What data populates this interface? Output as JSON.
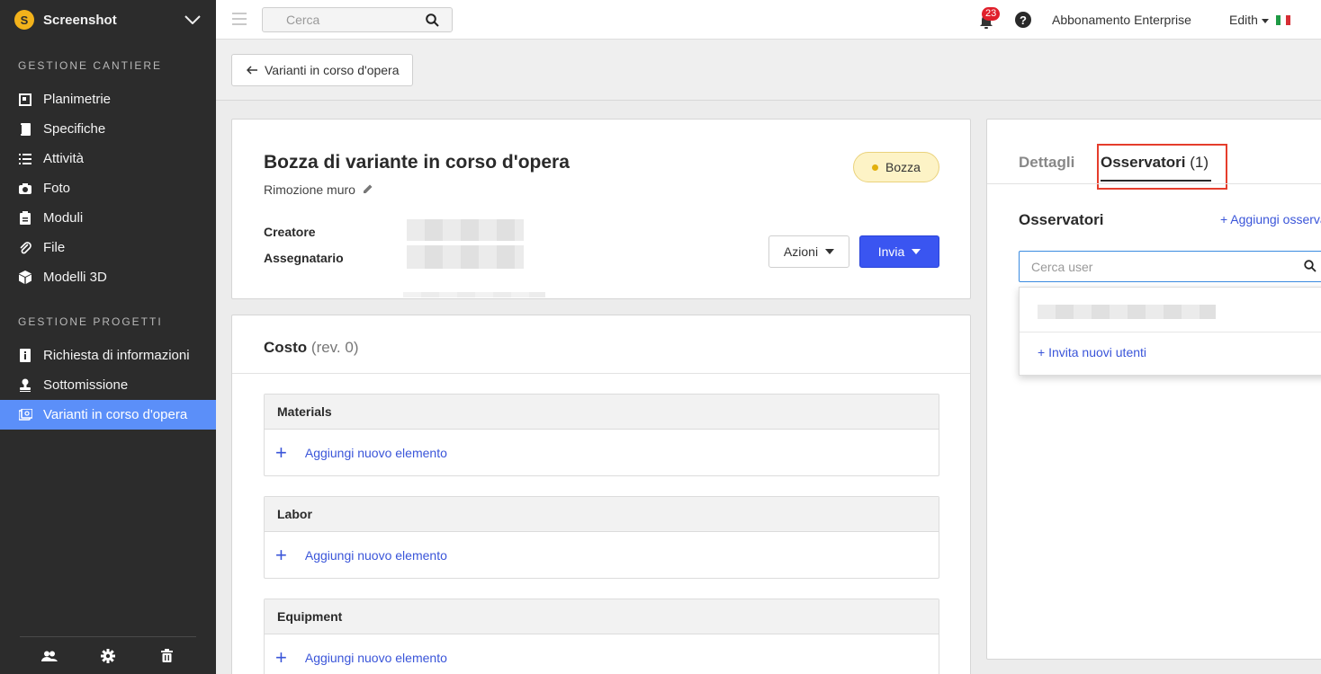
{
  "app": {
    "name": "Screenshot",
    "logo_letter": "S"
  },
  "sidebar": {
    "sections": [
      {
        "label": "GESTIONE CANTIERE"
      },
      {
        "label": "GESTIONE PROGETTI"
      }
    ],
    "items": [
      {
        "label": "Planimetrie",
        "icon": "floorplan-icon"
      },
      {
        "label": "Specifiche",
        "icon": "specs-book-icon"
      },
      {
        "label": "Attività",
        "icon": "list-icon"
      },
      {
        "label": "Foto",
        "icon": "camera-icon"
      },
      {
        "label": "Moduli",
        "icon": "clipboard-icon"
      },
      {
        "label": "File",
        "icon": "paperclip-icon"
      },
      {
        "label": "Modelli 3D",
        "icon": "cube-icon"
      },
      {
        "label": "Richiesta di informazioni",
        "icon": "info-doc-icon"
      },
      {
        "label": "Sottomissione",
        "icon": "stamp-icon"
      },
      {
        "label": "Varianti in corso d'opera",
        "icon": "change-order-icon",
        "active": true
      }
    ],
    "footer_icons": [
      "users-icon",
      "gear-icon",
      "trash-icon"
    ]
  },
  "topbar": {
    "search_placeholder": "Cerca",
    "notifications_count": "23",
    "help_label": "?",
    "plan_label": "Abbonamento Enterprise",
    "user_name": "Edith",
    "flag": "italy-flag-icon"
  },
  "subhead": {
    "back_label": "Varianti in corso d'opera"
  },
  "change_order": {
    "title": "Bozza di variante in corso d'opera",
    "subtitle": "Rimozione muro",
    "status": "Bozza",
    "creator_label": "Creatore",
    "assignee_label": "Assegnatario",
    "actions_label": "Azioni",
    "send_label": "Invia"
  },
  "cost": {
    "title": "Costo",
    "revision": "(rev. 0)",
    "groups": [
      {
        "name": "Materials",
        "add_label": "Aggiungi nuovo elemento"
      },
      {
        "name": "Labor",
        "add_label": "Aggiungi nuovo elemento"
      },
      {
        "name": "Equipment",
        "add_label": "Aggiungi nuovo elemento"
      }
    ]
  },
  "panel": {
    "tab_details": "Dettagli",
    "tab_observers": "Osservatori",
    "tab_observers_count": "(1)",
    "observers_title": "Osservatori",
    "add_observer": "+ Aggiungi osservatore",
    "user_search_placeholder": "Cerca user",
    "invite_label": "+ Invita nuovi utenti"
  },
  "colors": {
    "accent": "#3a55f1",
    "sidebar_bg": "#2c2c2c",
    "active_item": "#5b8ff9",
    "status_bg": "#fdf3c6",
    "highlight": "#e53d2c"
  }
}
